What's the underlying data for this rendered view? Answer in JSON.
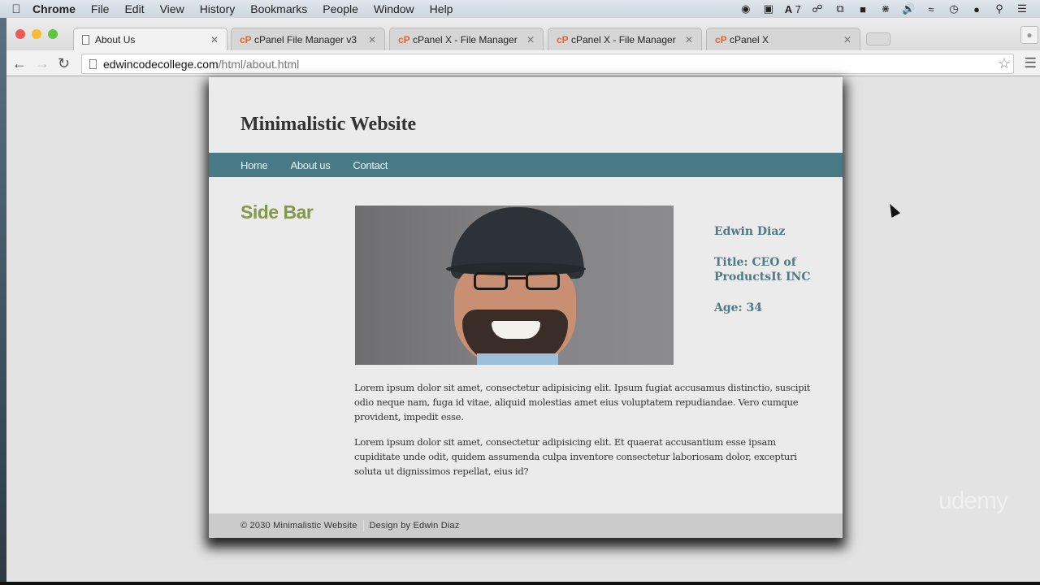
{
  "menubar": {
    "app": "Chrome",
    "items": [
      "File",
      "Edit",
      "View",
      "History",
      "Bookmarks",
      "People",
      "Window",
      "Help"
    ],
    "tray": {
      "adobe_badge": "7"
    }
  },
  "browser": {
    "tabs": [
      {
        "title": "About Us",
        "favicon": "page-icon",
        "active": true
      },
      {
        "title": "cPanel File Manager v3",
        "favicon": "cpanel-icon",
        "active": false
      },
      {
        "title": "cPanel X - File Manager",
        "favicon": "cpanel-icon",
        "active": false
      },
      {
        "title": "cPanel X - File Manager",
        "favicon": "cpanel-icon",
        "active": false
      },
      {
        "title": "cPanel X",
        "favicon": "cpanel-icon",
        "active": false
      }
    ],
    "url": {
      "host": "edwincodecollege.com",
      "path": "/html/about.html"
    }
  },
  "site": {
    "title": "Minimalistic Website",
    "nav": [
      "Home",
      "About us",
      "Contact"
    ],
    "sidebar_title": "Side Bar",
    "profile": {
      "name": "Edwin Diaz",
      "title": "Title: CEO of ProductsIt INC",
      "age": "Age: 34"
    },
    "paragraphs": [
      "Lorem ipsum dolor sit amet, consectetur adipisicing elit. Ipsum fugiat accusamus distinctio, suscipit odio neque nam, fuga id vitae, aliquid molestias amet eius voluptatem repudiandae. Vero cumque provident, impedit esse.",
      "Lorem ipsum dolor sit amet, consectetur adipisicing elit. Et quaerat accusantium esse ipsam cupiditate unde odit, quidem assumenda culpa inventore consectetur laboriosam dolor, excepturi soluta ut dignissimos repellat, eius id?"
    ],
    "footer": {
      "copyright": "© 2030 Minimalistic Website",
      "credit": "Design by Edwin Diaz"
    }
  },
  "watermark": "udemy"
}
